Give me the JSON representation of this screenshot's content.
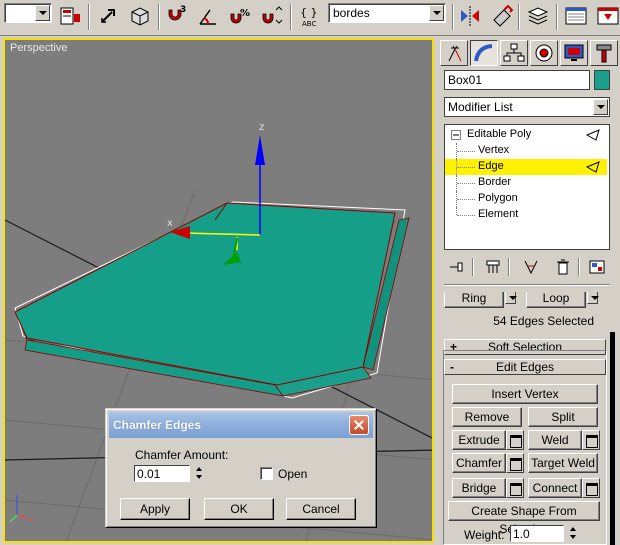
{
  "toolbar": {
    "left_combo_value": "",
    "named_selection_value": "bordes"
  },
  "viewport": {
    "label": "Perspective",
    "axis_z": "z",
    "axis_x": "x"
  },
  "command_panel": {
    "object_name": "Box01",
    "object_color": "#19a08a",
    "modifier_list": "Modifier List",
    "stack": [
      {
        "label": "Editable Poly",
        "level": 0
      },
      {
        "label": "Vertex",
        "level": 1
      },
      {
        "label": "Edge",
        "level": 1,
        "selected": true
      },
      {
        "label": "Border",
        "level": 1
      },
      {
        "label": "Polygon",
        "level": 1
      },
      {
        "label": "Element",
        "level": 1
      }
    ],
    "ring_label": "Ring",
    "loop_label": "Loop",
    "selection_status": "54 Edges Selected",
    "soft_selection": {
      "sign": "+",
      "title": "Soft Selection"
    },
    "edit_edges": {
      "sign": "-",
      "title": "Edit Edges"
    },
    "buttons": {
      "insert_vertex": "Insert Vertex",
      "remove": "Remove",
      "split": "Split",
      "extrude": "Extrude",
      "weld": "Weld",
      "chamfer": "Chamfer",
      "target_weld": "Target Weld",
      "bridge": "Bridge",
      "connect": "Connect",
      "create_shape": "Create Shape From Selection"
    },
    "weight_label": "Weight:",
    "weight_value": "1.0"
  },
  "dialog": {
    "title": "Chamfer Edges",
    "amount_label": "Chamfer Amount:",
    "amount_value": "0.01",
    "open_label": "Open",
    "open_checked": false,
    "apply": "Apply",
    "ok": "OK",
    "cancel": "Cancel"
  }
}
